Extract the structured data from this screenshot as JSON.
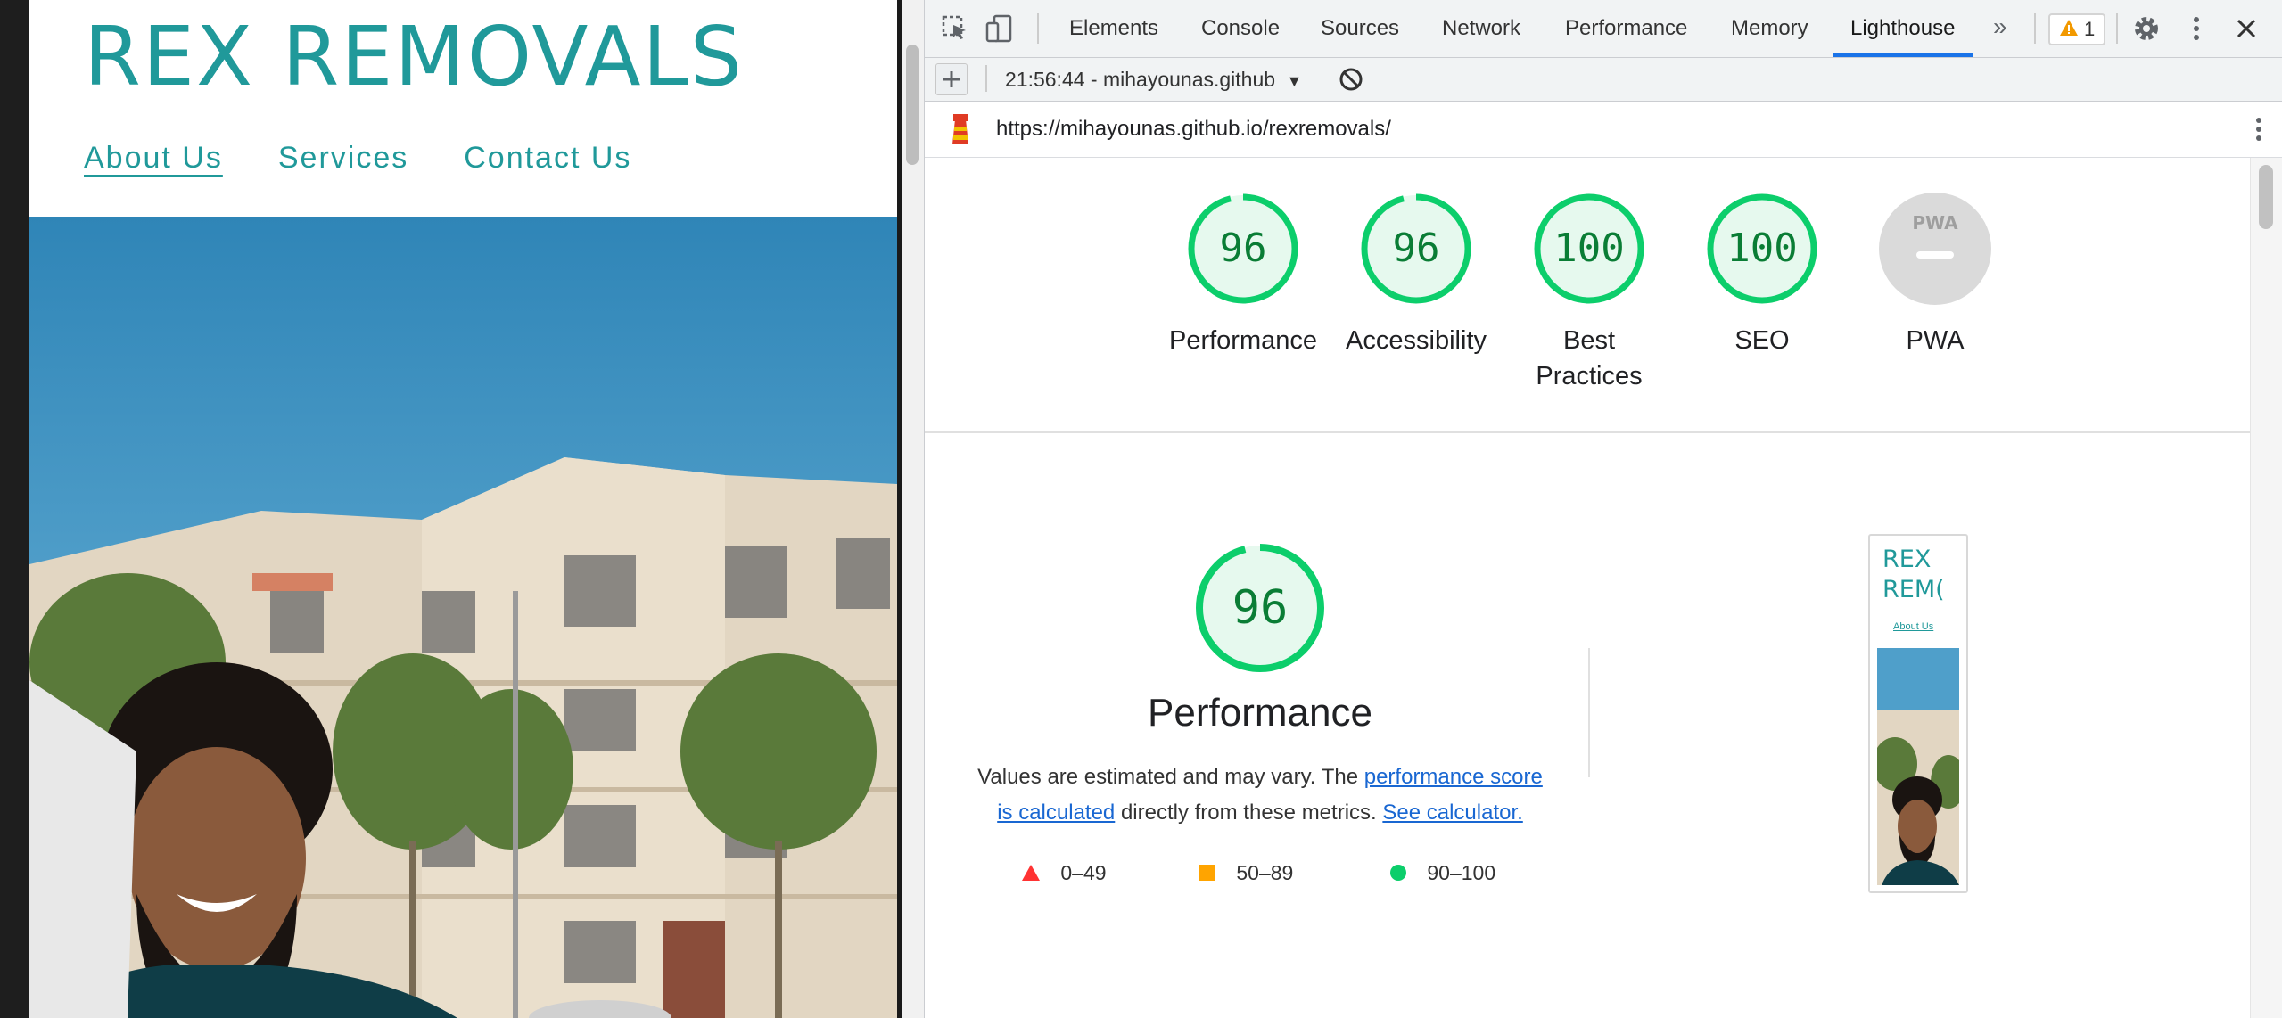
{
  "site": {
    "brand": "REX REMOVALS",
    "nav": [
      {
        "label": "About Us"
      },
      {
        "label": "Services"
      },
      {
        "label": "Contact Us"
      }
    ]
  },
  "devtools": {
    "tabs": [
      "Elements",
      "Console",
      "Sources",
      "Network",
      "Performance",
      "Memory",
      "Lighthouse"
    ],
    "active_tab": "Lighthouse",
    "more_tabs_icon": "double-chevron-right-icon",
    "warning_count": "1",
    "report_selector": "21:56:44 - mihayounas.github",
    "url": "https://mihayounas.github.io/rexremovals/",
    "accent_color": "#1a73e8"
  },
  "lighthouse": {
    "scores": [
      {
        "label": "Performance",
        "value": "96",
        "fraction": 0.96
      },
      {
        "label": "Accessibility",
        "value": "96",
        "fraction": 0.96
      },
      {
        "label": "Best Practices",
        "value": "100",
        "fraction": 1.0
      },
      {
        "label": "SEO",
        "value": "100",
        "fraction": 1.0
      },
      {
        "label": "PWA",
        "value": "PWA",
        "fraction": null
      }
    ],
    "pass_color": "#0cce6b",
    "performance": {
      "score": "96",
      "title": "Performance",
      "desc_prefix": "Values are estimated and may vary. The",
      "link1": "performance score is calculated",
      "desc_middle": "directly from these metrics.",
      "link2": "See calculator."
    },
    "legend": [
      {
        "range": "0–49",
        "shape": "triangle",
        "color": "#ff3333"
      },
      {
        "range": "50–89",
        "shape": "square",
        "color": "#ffa400"
      },
      {
        "range": "90–100",
        "shape": "circle",
        "color": "#0cce6b"
      }
    ],
    "thumbnail": {
      "brand_line1": "REX",
      "brand_line2": "REM(",
      "nav_label": "About Us"
    }
  }
}
